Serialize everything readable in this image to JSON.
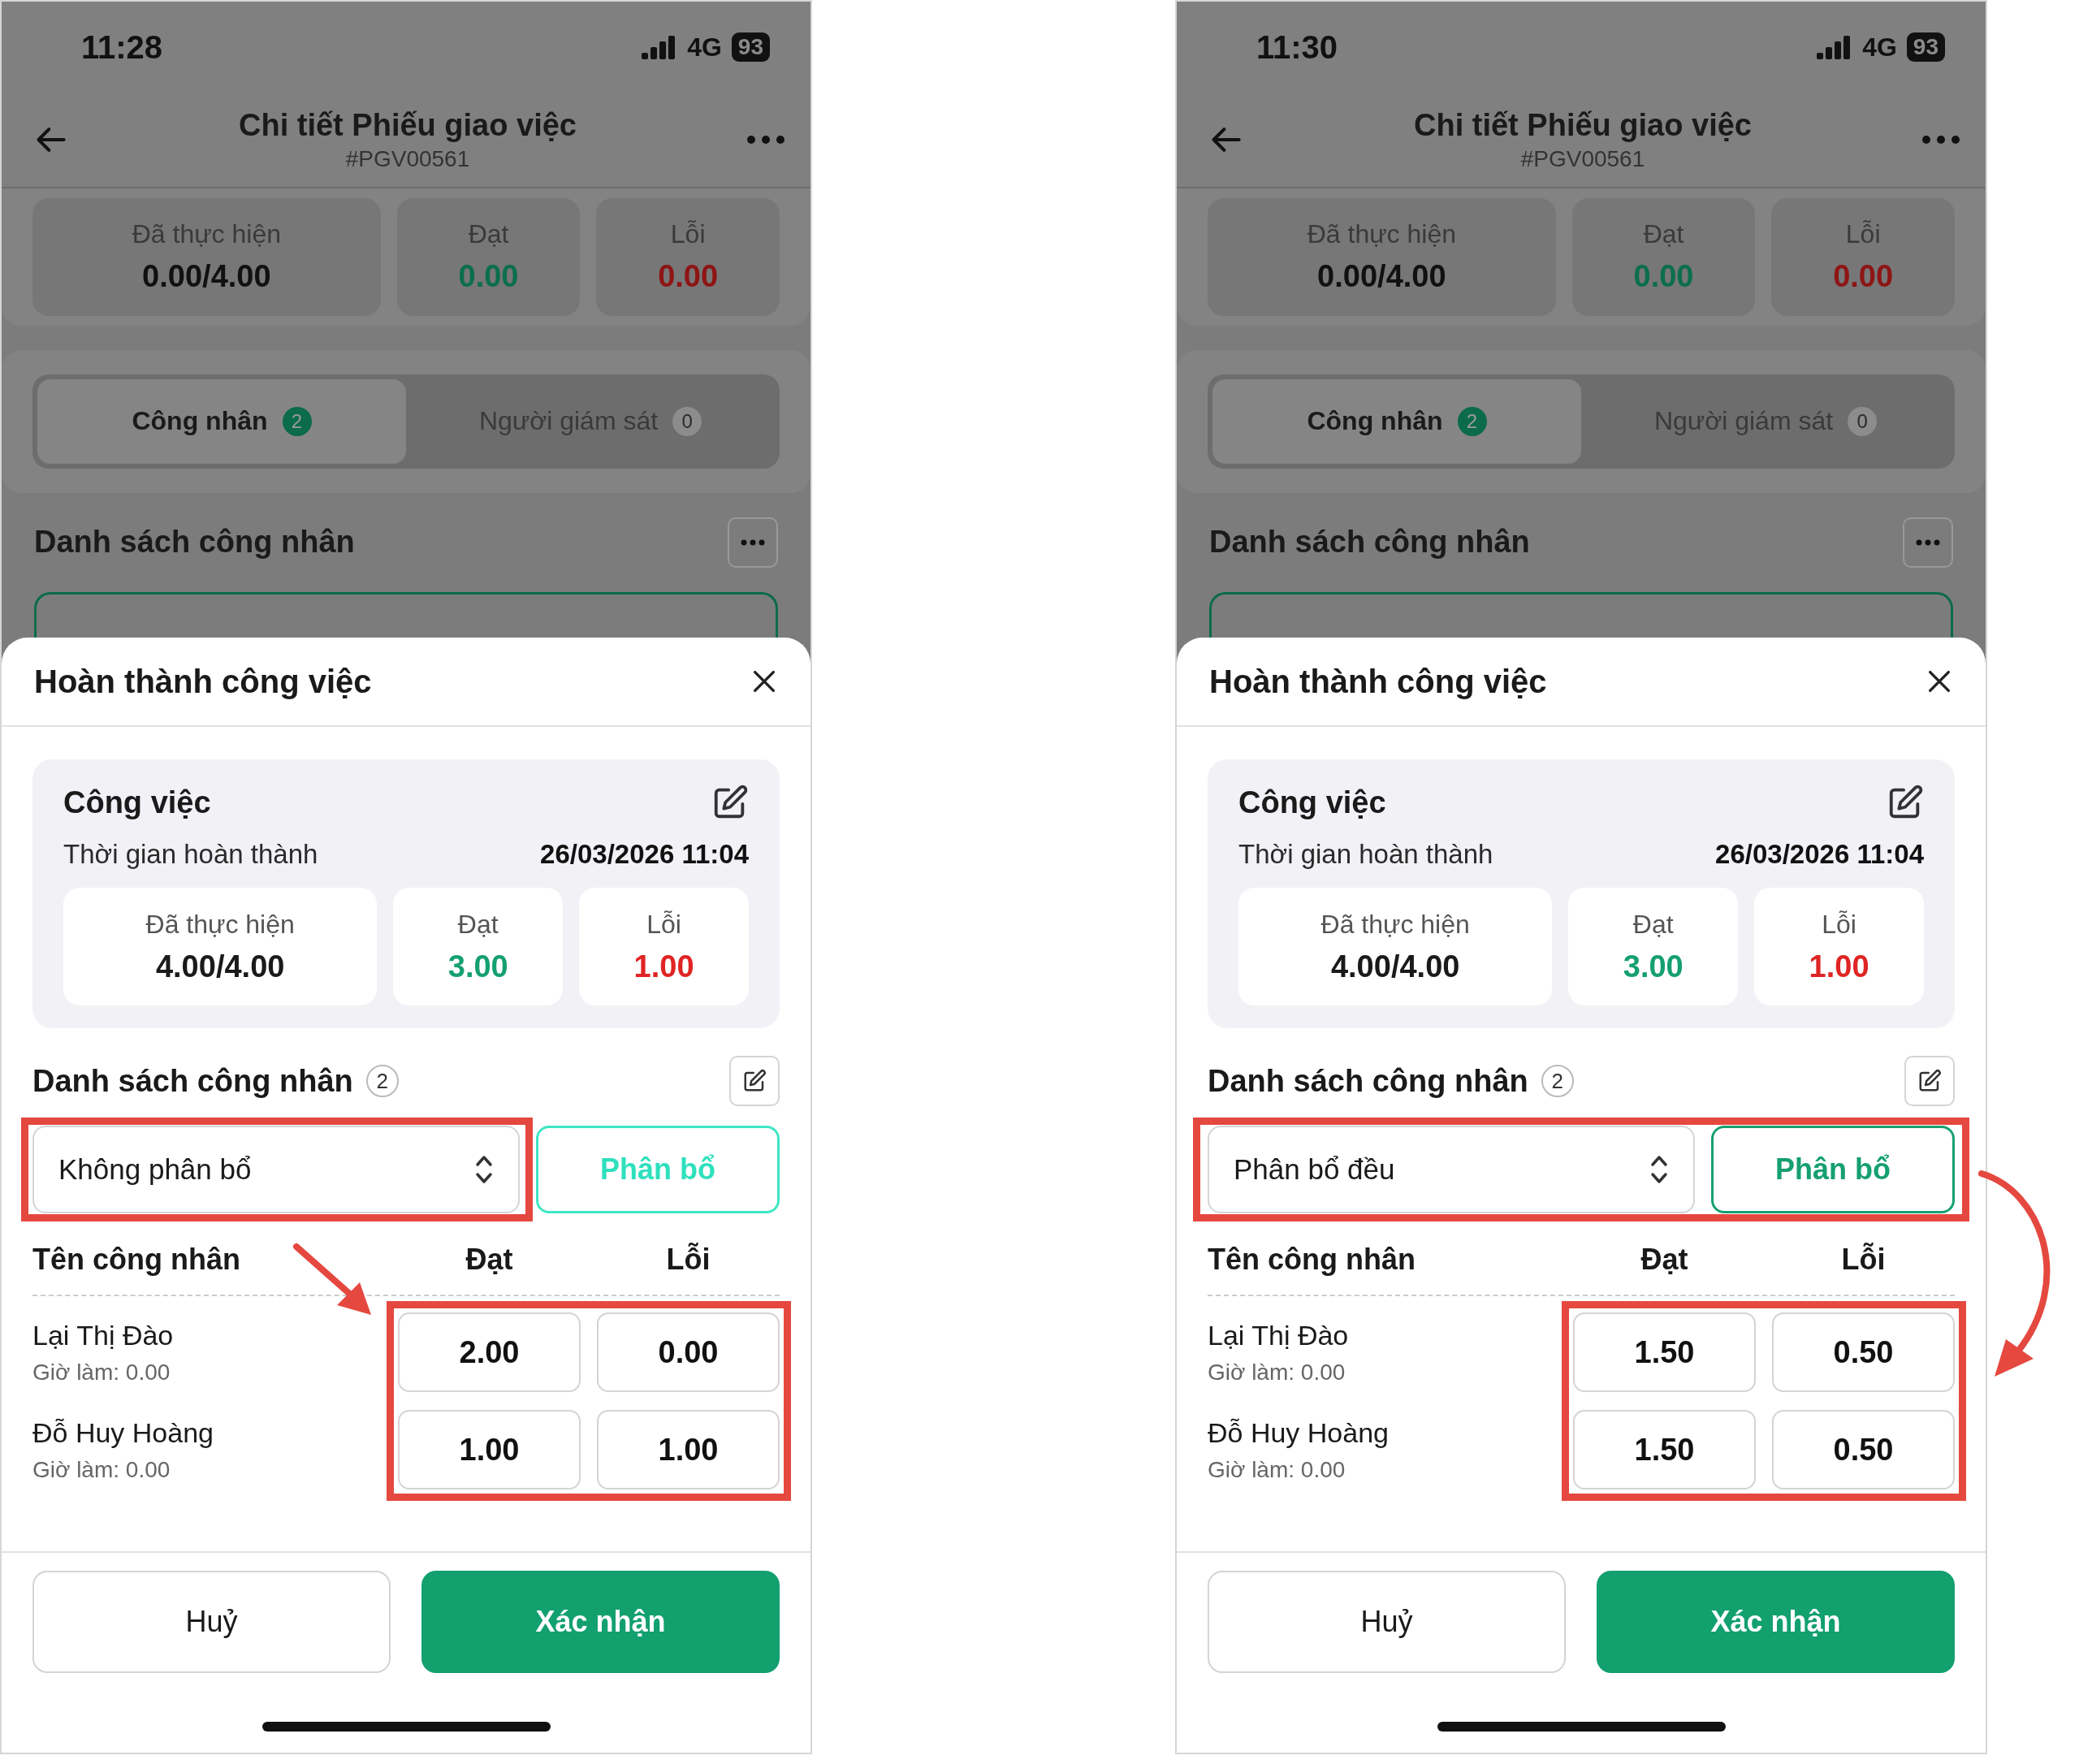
{
  "phones": [
    {
      "status_bar": {
        "time": "11:28",
        "network": "4G",
        "battery": "93"
      },
      "header": {
        "title": "Chi tiết Phiếu giao việc",
        "code": "#PGV00561"
      },
      "summary": [
        {
          "label": "Đã thực hiện",
          "value": "0.00/4.00",
          "color": "#111111"
        },
        {
          "label": "Đạt",
          "value": "0.00",
          "color": "#0b6e4c"
        },
        {
          "label": "Lỗi",
          "value": "0.00",
          "color": "#8e1515"
        }
      ],
      "tabs": [
        {
          "label": "Công nhân",
          "count": "2",
          "selected": true
        },
        {
          "label": "Người giám sát",
          "count": "0",
          "selected": false
        }
      ],
      "section_title": "Danh sách công nhân",
      "sheet": {
        "title": "Hoàn thành công việc",
        "task": {
          "title": "Công việc",
          "time_label": "Thời gian hoàn thành",
          "time_value": "26/03/2026 11:04",
          "stats": [
            {
              "label": "Đã thực hiện",
              "value": "4.00/4.00",
              "color": "#1a1a1a"
            },
            {
              "label": "Đạt",
              "value": "3.00",
              "color": "#15a06f"
            },
            {
              "label": "Lỗi",
              "value": "1.00",
              "color": "#e02424"
            }
          ]
        },
        "workers_title": "Danh sách công nhân",
        "workers_count": "2",
        "mode": "Không phân bổ",
        "distribute_button": {
          "label": "Phân bổ",
          "pressed": true
        },
        "columns": [
          "Tên công nhân",
          "Đạt",
          "Lỗi"
        ],
        "workers": [
          {
            "name": "Lại Thị Đào",
            "hours": "Giờ làm: 0.00",
            "pass": "2.00",
            "fail": "0.00"
          },
          {
            "name": "Đỗ Huy Hoàng",
            "hours": "Giờ làm: 0.00",
            "pass": "1.00",
            "fail": "1.00"
          }
        ],
        "cancel": "Huỷ",
        "confirm": "Xác nhận"
      },
      "highlight_includes_button": false,
      "curved_arrow": false
    },
    {
      "status_bar": {
        "time": "11:30",
        "network": "4G",
        "battery": "93"
      },
      "header": {
        "title": "Chi tiết Phiếu giao việc",
        "code": "#PGV00561"
      },
      "summary": [
        {
          "label": "Đã thực hiện",
          "value": "0.00/4.00",
          "color": "#111111"
        },
        {
          "label": "Đạt",
          "value": "0.00",
          "color": "#0b6e4c"
        },
        {
          "label": "Lỗi",
          "value": "0.00",
          "color": "#8e1515"
        }
      ],
      "tabs": [
        {
          "label": "Công nhân",
          "count": "2",
          "selected": true
        },
        {
          "label": "Người giám sát",
          "count": "0",
          "selected": false
        }
      ],
      "section_title": "Danh sách công nhân",
      "sheet": {
        "title": "Hoàn thành công việc",
        "task": {
          "title": "Công việc",
          "time_label": "Thời gian hoàn thành",
          "time_value": "26/03/2026 11:04",
          "stats": [
            {
              "label": "Đã thực hiện",
              "value": "4.00/4.00",
              "color": "#1a1a1a"
            },
            {
              "label": "Đạt",
              "value": "3.00",
              "color": "#15a06f"
            },
            {
              "label": "Lỗi",
              "value": "1.00",
              "color": "#e02424"
            }
          ]
        },
        "workers_title": "Danh sách công nhân",
        "workers_count": "2",
        "mode": "Phân bổ đều",
        "distribute_button": {
          "label": "Phân bổ",
          "pressed": false
        },
        "columns": [
          "Tên công nhân",
          "Đạt",
          "Lỗi"
        ],
        "workers": [
          {
            "name": "Lại Thị Đào",
            "hours": "Giờ làm: 0.00",
            "pass": "1.50",
            "fail": "0.50"
          },
          {
            "name": "Đỗ Huy Hoàng",
            "hours": "Giờ làm: 0.00",
            "pass": "1.50",
            "fail": "0.50"
          }
        ],
        "cancel": "Huỷ",
        "confirm": "Xác nhận"
      },
      "highlight_includes_button": true,
      "curved_arrow": true
    }
  ]
}
